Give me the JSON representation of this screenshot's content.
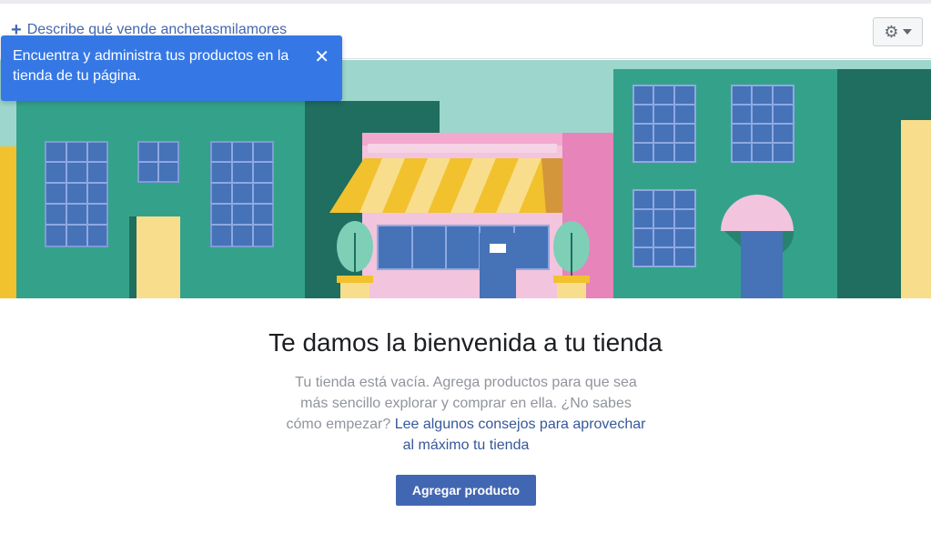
{
  "header": {
    "describe_link": "Describe qué vende anchetasmilamores",
    "plus_glyph": "+",
    "gear_glyph": "⚙"
  },
  "tooltip": {
    "text": "Encuentra y administra tus productos en la tienda de tu página.",
    "close_glyph": "✕"
  },
  "welcome": {
    "title": "Te damos la bienvenida a tu tienda",
    "body": "Tu tienda está vacía. Agrega productos para que sea más sencillo explorar y comprar en ella. ¿No sabes cómo empezar?",
    "tips_link": "Lee algunos consejos para aprovechar al máximo tu tienda",
    "add_button": "Agregar producto"
  },
  "colors": {
    "accent": "#4267b2",
    "tooltip": "#3578e5",
    "sky": "#9dd6cc",
    "building_green": "#34a28a",
    "building_dark": "#1f6e5f",
    "window_blue": "#4672b8",
    "yellow": "#f2c12e",
    "pink": "#f3c4dd"
  },
  "icons": [
    "plus-icon",
    "gear-icon",
    "chevron-down-icon",
    "close-icon"
  ]
}
